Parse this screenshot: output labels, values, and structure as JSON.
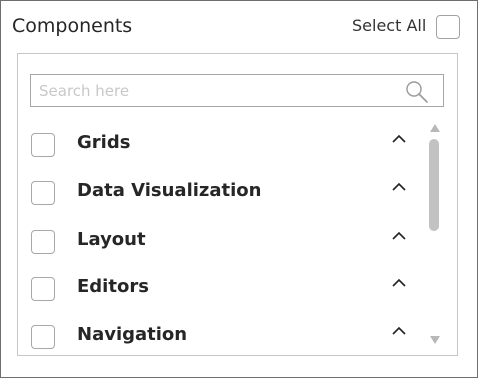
{
  "header": {
    "title": "Components",
    "select_all_label": "Select All"
  },
  "search": {
    "placeholder": "Search here",
    "value": ""
  },
  "items": [
    {
      "label": "Grids",
      "checked": false,
      "expanded": true
    },
    {
      "label": "Data Visualization",
      "checked": false,
      "expanded": true
    },
    {
      "label": "Layout",
      "checked": false,
      "expanded": true
    },
    {
      "label": "Editors",
      "checked": false,
      "expanded": true
    },
    {
      "label": "Navigation",
      "checked": false,
      "expanded": true
    }
  ],
  "icons": {
    "search": "search-icon",
    "chevron": "chevron-up-icon",
    "scroll_up": "triangle-up-icon",
    "scroll_down": "triangle-down-icon"
  },
  "colors": {
    "border": "#6f6f6f",
    "text": "#262626",
    "checkbox_border": "#a8a8a8",
    "scroll_thumb": "#c2c2c2"
  }
}
